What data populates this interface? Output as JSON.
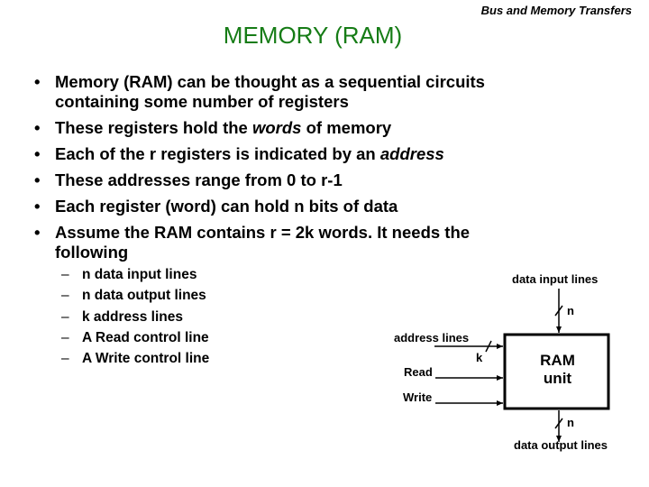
{
  "header": {
    "section_title": "Bus and Memory Transfers"
  },
  "slide": {
    "title": "MEMORY (RAM)",
    "title_color": "#167c16",
    "bullets": [
      {
        "parts": [
          "Memory (RAM) can be thought as a sequential circuits containing some number of registers"
        ]
      },
      {
        "before": "These registers hold the ",
        "emph": "words",
        "after": " of memory"
      },
      {
        "before": "Each of the r registers is indicated by an ",
        "emph": "address",
        "after": ""
      },
      {
        "parts": [
          "These addresses range from 0 to r-1"
        ]
      },
      {
        "parts": [
          "Each register (word) can hold n bits of data"
        ]
      },
      {
        "parts": [
          "Assume the RAM contains r = 2k words. It needs the following"
        ]
      }
    ],
    "bullet_glyph": "•",
    "sub_items": [
      "n data input lines",
      "n data output lines",
      "k address lines",
      "A Read control line",
      "A Write control line"
    ],
    "sub_glyph": "–"
  },
  "diagram": {
    "unit_label_line1": "RAM",
    "unit_label_line2": "unit",
    "data_input_label": "data input lines",
    "data_input_width": "n",
    "data_output_label": "data output lines",
    "data_output_width": "n",
    "address_label": "address lines",
    "address_width": "k",
    "read_label": "Read",
    "write_label": "Write"
  }
}
